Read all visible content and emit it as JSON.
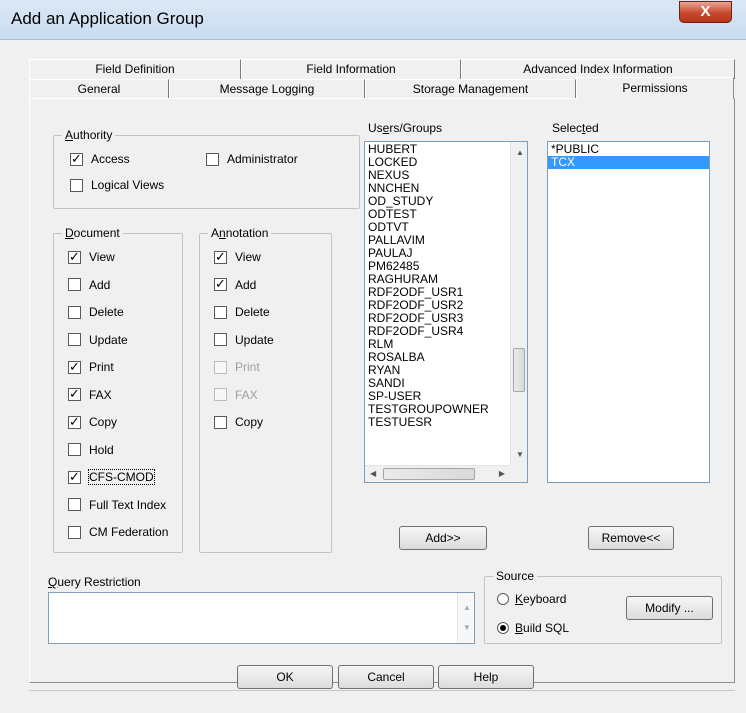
{
  "window": {
    "title": "Add an Application Group",
    "close_label": "X"
  },
  "tabs": {
    "row1": [
      "Field Definition",
      "Field Information",
      "Advanced Index Information"
    ],
    "row2": [
      "General",
      "Message Logging",
      "Storage Management"
    ],
    "active": "Permissions"
  },
  "authority": {
    "label": "Authority",
    "access": {
      "label": "Access",
      "checked": true
    },
    "administrator": {
      "label": "Administrator",
      "checked": false
    },
    "logical_views": {
      "label": "Logical Views",
      "checked": false
    }
  },
  "document": {
    "label": "Document",
    "items": [
      {
        "label": "View",
        "checked": true
      },
      {
        "label": "Add",
        "checked": false
      },
      {
        "label": "Delete",
        "checked": false
      },
      {
        "label": "Update",
        "checked": false
      },
      {
        "label": "Print",
        "checked": true
      },
      {
        "label": "FAX",
        "checked": true
      },
      {
        "label": "Copy",
        "checked": true
      },
      {
        "label": "Hold",
        "checked": false
      },
      {
        "label": "CFS-CMOD",
        "checked": true
      },
      {
        "label": "Full Text Index",
        "checked": false
      },
      {
        "label": "CM Federation",
        "checked": false
      }
    ]
  },
  "annotation": {
    "label": "Annotation",
    "items": [
      {
        "label": "View",
        "checked": true,
        "disabled": false
      },
      {
        "label": "Add",
        "checked": true,
        "disabled": false
      },
      {
        "label": "Delete",
        "checked": false,
        "disabled": false
      },
      {
        "label": "Update",
        "checked": false,
        "disabled": false
      },
      {
        "label": "Print",
        "checked": false,
        "disabled": true
      },
      {
        "label": "FAX",
        "checked": false,
        "disabled": true
      },
      {
        "label": "Copy",
        "checked": false,
        "disabled": false
      }
    ]
  },
  "users_groups": {
    "label": "Users/Groups",
    "items": [
      "HUBERT",
      "LOCKED",
      "NEXUS",
      "NNCHEN",
      "OD_STUDY",
      "ODTEST",
      "ODTVT",
      "PALLAVIM",
      "PAULAJ",
      "PM62485",
      "RAGHURAM",
      "RDF2ODF_USR1",
      "RDF2ODF_USR2",
      "RDF2ODF_USR3",
      "RDF2ODF_USR4",
      "RLM",
      "ROSALBA",
      "RYAN",
      "SANDI",
      "SP-USER",
      "TESTGROUPOWNER",
      "TESTUESR"
    ],
    "add_button": "Add>>"
  },
  "selected": {
    "label": "Selected",
    "items": [
      "*PUBLIC",
      "TCX"
    ],
    "selected_item": "TCX",
    "remove_button": "Remove<<"
  },
  "query_restriction": {
    "label": "Query Restriction",
    "value": ""
  },
  "source": {
    "label": "Source",
    "keyboard": {
      "label": "Keyboard",
      "checked": false
    },
    "build_sql": {
      "label": "Build SQL",
      "checked": true
    },
    "modify_button": "Modify ..."
  },
  "footer": {
    "ok": "OK",
    "cancel": "Cancel",
    "help": "Help"
  }
}
